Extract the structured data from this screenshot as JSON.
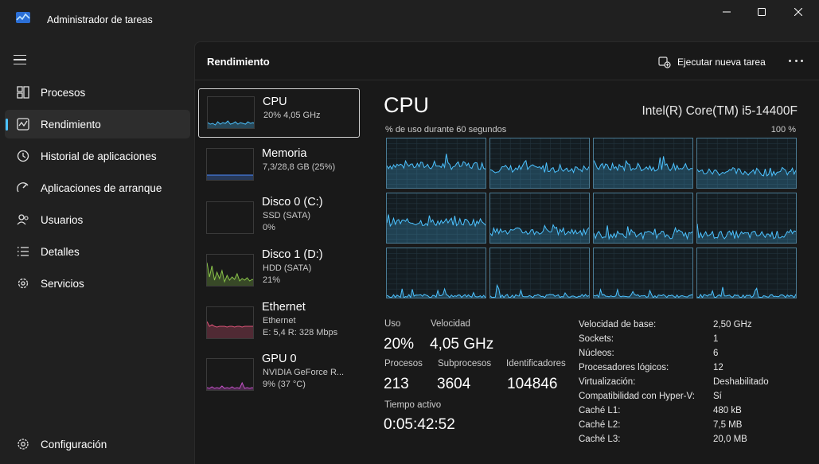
{
  "window": {
    "title": "Administrador de tareas"
  },
  "nav": {
    "items": [
      {
        "label": "Procesos",
        "icon": "processes-icon"
      },
      {
        "label": "Rendimiento",
        "icon": "performance-icon",
        "active": true
      },
      {
        "label": "Historial de aplicaciones",
        "icon": "history-icon"
      },
      {
        "label": "Aplicaciones de arranque",
        "icon": "startup-icon"
      },
      {
        "label": "Usuarios",
        "icon": "users-icon"
      },
      {
        "label": "Detalles",
        "icon": "details-icon"
      },
      {
        "label": "Servicios",
        "icon": "services-icon"
      }
    ],
    "settings_label": "Configuración"
  },
  "header": {
    "title": "Rendimiento",
    "new_task_label": "Ejecutar nueva tarea"
  },
  "devices": [
    {
      "name": "CPU",
      "line1": "20%  4,05 GHz",
      "line2": "",
      "color": "#4cc2ff",
      "selected": true
    },
    {
      "name": "Memoria",
      "line1": "7,3/28,8 GB (25%)",
      "line2": "",
      "color": "#4c8cff"
    },
    {
      "name": "Disco 0 (C:)",
      "line1": "SSD (SATA)",
      "line2": "0%",
      "color": "#8ac44a"
    },
    {
      "name": "Disco 1 (D:)",
      "line1": "HDD (SATA)",
      "line2": "21%",
      "color": "#8ac44a"
    },
    {
      "name": "Ethernet",
      "line1": "Ethernet",
      "line2": "E: 5,4  R: 328 Mbps",
      "color": "#e0557a"
    },
    {
      "name": "GPU 0",
      "line1": "NVIDIA GeForce R...",
      "line2": "9%  (37 °C)",
      "color": "#c451c8"
    }
  ],
  "cpu": {
    "title": "CPU",
    "model": "Intel(R) Core(TM) i5-14400F",
    "usage_caption": "% de uso durante 60 segundos",
    "usage_max": "100 %",
    "accent": "#4cc2ff",
    "stats": {
      "usage_label": "Uso",
      "usage_value": "20%",
      "speed_label": "Velocidad",
      "speed_value": "4,05 GHz",
      "processes_label": "Procesos",
      "processes_value": "213",
      "threads_label": "Subprocesos",
      "threads_value": "3604",
      "handles_label": "Identificadores",
      "handles_value": "104846",
      "uptime_label": "Tiempo activo",
      "uptime_value": "0:05:42:52"
    },
    "specs": [
      {
        "k": "Velocidad de base:",
        "v": "2,50 GHz"
      },
      {
        "k": "Sockets:",
        "v": "1"
      },
      {
        "k": "Núcleos:",
        "v": "6"
      },
      {
        "k": "Procesadores lógicos:",
        "v": "12"
      },
      {
        "k": "Virtualización:",
        "v": "Deshabilitado"
      },
      {
        "k": "Compatibilidad con Hyper-V:",
        "v": "Sí"
      },
      {
        "k": "Caché L1:",
        "v": "480 kB"
      },
      {
        "k": "Caché L2:",
        "v": "7,5 MB"
      },
      {
        "k": "Caché L3:",
        "v": "20,0 MB"
      }
    ]
  }
}
